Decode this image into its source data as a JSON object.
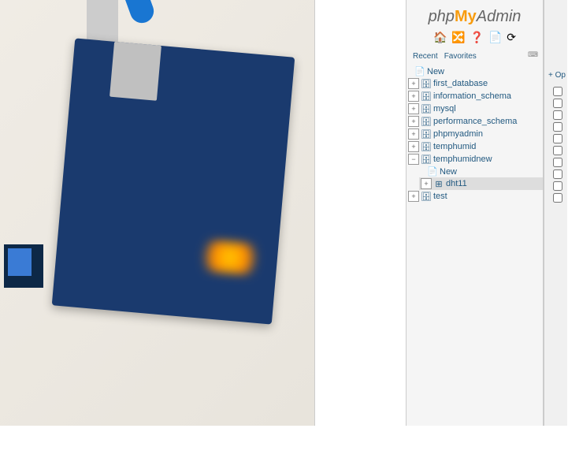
{
  "logo": {
    "php": "php",
    "my": "My",
    "admin": "Admin"
  },
  "toolbar": {
    "home": "🏠",
    "logout": "🔀",
    "docs": "❓",
    "sql": "📄",
    "reload": "⟳"
  },
  "tabs": {
    "recent": "Recent",
    "favorites": "Favorites"
  },
  "tree": {
    "new": "New",
    "items": [
      {
        "label": "first_database"
      },
      {
        "label": "information_schema"
      },
      {
        "label": "mysql"
      },
      {
        "label": "performance_schema"
      },
      {
        "label": "phpmyadmin"
      },
      {
        "label": "temphumid"
      }
    ],
    "expanded": {
      "label": "temphumidnew",
      "new": "New",
      "table": "dht11"
    },
    "last": {
      "label": "test"
    }
  },
  "options_link": "+ Op"
}
